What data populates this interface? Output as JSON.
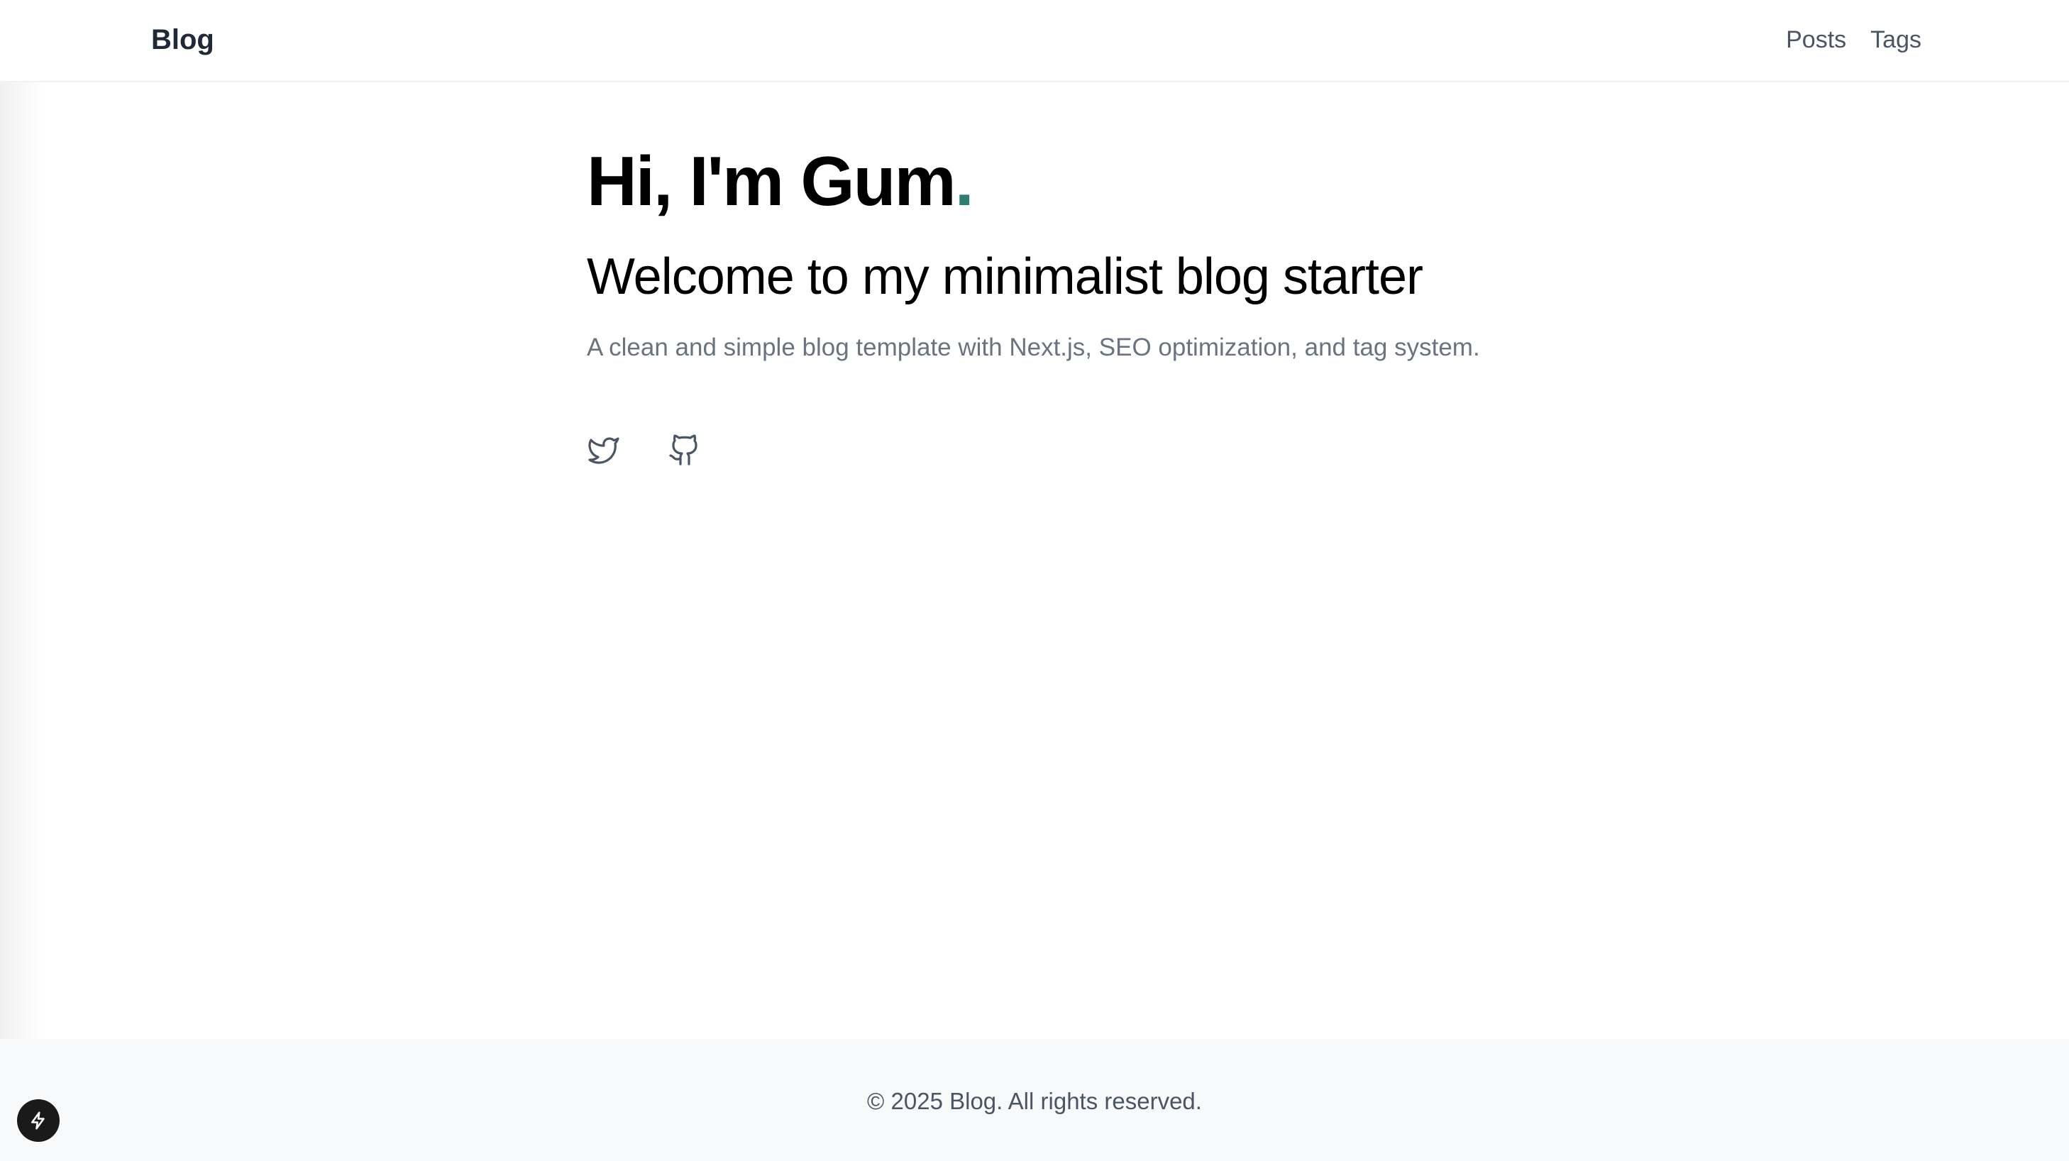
{
  "header": {
    "brand": "Blog",
    "nav": [
      {
        "label": "Posts"
      },
      {
        "label": "Tags"
      }
    ]
  },
  "hero": {
    "title": "Hi, I'm Gum",
    "title_dot": ".",
    "subtitle": "Welcome to my minimalist blog starter",
    "description": "A clean and simple blog template with Next.js, SEO optimization, and tag system."
  },
  "socials": [
    {
      "icon": "twitter-icon"
    },
    {
      "icon": "github-icon"
    }
  ],
  "footer": {
    "copyright": "© 2025 Blog. All rights reserved."
  },
  "dev_indicator": {
    "icon": "lightning-icon"
  },
  "colors": {
    "accent": "#2f7d73",
    "text_muted": "#6b7280",
    "footer_bg": "#f8f9fb"
  }
}
